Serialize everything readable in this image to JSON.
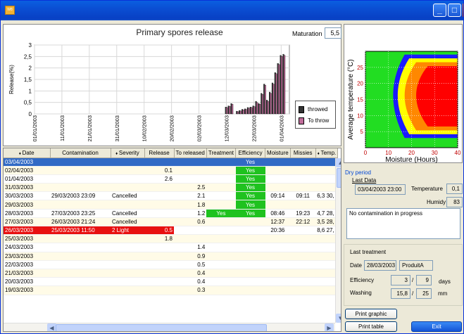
{
  "window": {
    "icon_text": "W8",
    "buttons": [
      "_",
      "□",
      "X"
    ]
  },
  "chart": {
    "title": "Primary spores release",
    "maturation_label": "Maturation",
    "maturation_value": "5,5",
    "legend": [
      "throwed",
      "To throw"
    ]
  },
  "chart_data": [
    {
      "type": "bar",
      "title": "Primary spores release",
      "ylabel": "Release(%)",
      "ylim": [
        0,
        3
      ],
      "yticks": [
        "0",
        "0,5",
        "1",
        "1,5",
        "2",
        "2,5",
        "3"
      ],
      "xticks": [
        "01/01/2003",
        "11/01/2003",
        "21/01/2003",
        "31/01/2003",
        "10/02/2003",
        "20/02/2003",
        "02/03/2003",
        "12/03/2003",
        "22/03/2003",
        "01/04/2003"
      ],
      "x_start": "2003-01-01",
      "x_end": "2003-04-04",
      "series": [
        {
          "name": "throwed",
          "color": "#333333",
          "x": [
            "2003-03-12",
            "2003-03-13",
            "2003-03-14",
            "2003-03-16",
            "2003-03-17",
            "2003-03-18",
            "2003-03-19",
            "2003-03-20",
            "2003-03-21",
            "2003-03-22",
            "2003-03-23",
            "2003-03-24",
            "2003-03-25",
            "2003-03-26",
            "2003-03-27",
            "2003-03-28",
            "2003-03-29",
            "2003-03-30",
            "2003-03-31",
            "2003-04-01",
            "2003-04-02"
          ],
          "values": [
            0.3,
            0.35,
            0.45,
            0.12,
            0.15,
            0.2,
            0.22,
            0.28,
            0.3,
            0.35,
            0.55,
            0.45,
            0.9,
            1.3,
            0.6,
            0.95,
            1.35,
            1.8,
            2.2,
            2.55,
            2.6
          ]
        },
        {
          "name": "To throw",
          "color": "#c06c9a",
          "x": [
            "2003-03-12",
            "2003-03-13",
            "2003-03-14",
            "2003-03-16",
            "2003-03-17",
            "2003-03-18",
            "2003-03-19",
            "2003-03-20",
            "2003-03-21",
            "2003-03-22",
            "2003-03-23",
            "2003-03-24",
            "2003-03-25",
            "2003-03-26",
            "2003-03-27",
            "2003-03-28",
            "2003-03-29",
            "2003-03-30",
            "2003-03-31",
            "2003-04-01",
            "2003-04-02"
          ],
          "values": [
            0.28,
            0.33,
            0.42,
            0.1,
            0.13,
            0.18,
            0.2,
            0.25,
            0.28,
            0.32,
            0.5,
            0.42,
            0.85,
            1.25,
            0.55,
            0.9,
            1.3,
            1.75,
            2.15,
            2.5,
            2.55
          ]
        }
      ]
    },
    {
      "type": "heatmap",
      "xlabel": "Moisture (Hours)",
      "ylabel": "Average temperature (°C)",
      "xlim": [
        0,
        40
      ],
      "ylim": [
        0,
        30
      ],
      "xticks": [
        "0",
        "10",
        "20",
        "30",
        "40"
      ],
      "yticks": [
        "5",
        "10",
        "15",
        "20",
        "25"
      ],
      "zone_colors": [
        "#22dd22",
        "#1a1aff",
        "#ffff00",
        "#ff8800",
        "#ff0000"
      ]
    }
  ],
  "table": {
    "headers": [
      "Date",
      "Contamination",
      "Severity",
      "Release",
      "To released",
      "Treatment",
      "Efficiency",
      "Moisture",
      "Missies",
      "Temp."
    ],
    "rows": [
      {
        "c": [
          "03/04/2003",
          "",
          "",
          "",
          "",
          "",
          "Yes",
          "",
          "",
          ""
        ],
        "sel": true
      },
      {
        "c": [
          "02/04/2003",
          "",
          "",
          "0.1",
          "",
          "",
          "Yes",
          "",
          "",
          ""
        ]
      },
      {
        "c": [
          "01/04/2003",
          "",
          "",
          "2.6",
          "",
          "",
          "Yes",
          "",
          "",
          ""
        ]
      },
      {
        "c": [
          "31/03/2003",
          "",
          "",
          "",
          "2.5",
          "",
          "Yes",
          "",
          "",
          ""
        ]
      },
      {
        "c": [
          "30/03/2003",
          "29/03/2003 23:09",
          "Cancelled",
          "",
          "2.1",
          "",
          "Yes",
          "09:14",
          "09:11",
          "6,3  30,"
        ]
      },
      {
        "c": [
          "29/03/2003",
          "",
          "",
          "",
          "1.8",
          "",
          "Yes",
          "",
          "",
          ""
        ]
      },
      {
        "c": [
          "28/03/2003",
          "27/03/2003 23:25",
          "Cancelled",
          "",
          "1.2",
          "Yes",
          "Yes",
          "08:46",
          "19:23",
          "4,7  28,"
        ]
      },
      {
        "c": [
          "27/03/2003",
          "26/03/2003 21:24",
          "Cancelled",
          "",
          "0.6",
          "",
          "",
          "12:37",
          "22:12",
          "3,5  28,"
        ]
      },
      {
        "c": [
          "26/03/2003",
          "25/03/2003 11:50",
          "2 Light",
          "0.5",
          "",
          "",
          "",
          "20:36",
          "",
          "8,6  27,"
        ],
        "hi": true
      },
      {
        "c": [
          "25/03/2003",
          "",
          "",
          "1.8",
          "",
          "",
          "",
          "",
          "",
          ""
        ]
      },
      {
        "c": [
          "24/03/2003",
          "",
          "",
          "",
          "1.4",
          "",
          "",
          "",
          "",
          ""
        ]
      },
      {
        "c": [
          "23/03/2003",
          "",
          "",
          "",
          "0.9",
          "",
          "",
          "",
          "",
          ""
        ]
      },
      {
        "c": [
          "22/03/2003",
          "",
          "",
          "",
          "0.5",
          "",
          "",
          "",
          "",
          ""
        ]
      },
      {
        "c": [
          "21/03/2003",
          "",
          "",
          "",
          "0.4",
          "",
          "",
          "",
          "",
          ""
        ]
      },
      {
        "c": [
          "20/03/2003",
          "",
          "",
          "",
          "0.4",
          "",
          "",
          "",
          "",
          ""
        ]
      },
      {
        "c": [
          "19/03/2003",
          "",
          "",
          "",
          "0.3",
          "",
          "",
          "",
          "",
          ""
        ]
      }
    ]
  },
  "dry_period": {
    "title": "Dry period",
    "last_data_label": "Last Data",
    "last_data_value": "03/04/2003 23:00",
    "temperature_label": "Temperature",
    "temperature_value": "0,1",
    "humidity_label": "Humidy",
    "humidity_value": "83",
    "message": "No contamination in progress"
  },
  "treatment": {
    "title": "Last treatment",
    "date_label": "Date",
    "date_value": "28/03/2003",
    "product_value": "ProduitA",
    "efficiency_label": "Efficiency",
    "efficiency_value": "3",
    "efficiency_total": "9",
    "efficiency_unit": "days",
    "slash": "/",
    "washing_label": "Washing",
    "washing_value": "15,8",
    "washing_total": "25",
    "washing_unit": "mm"
  },
  "buttons": {
    "print_graphic": "Print graphic",
    "print_table": "Print table",
    "exit": "Exit"
  }
}
